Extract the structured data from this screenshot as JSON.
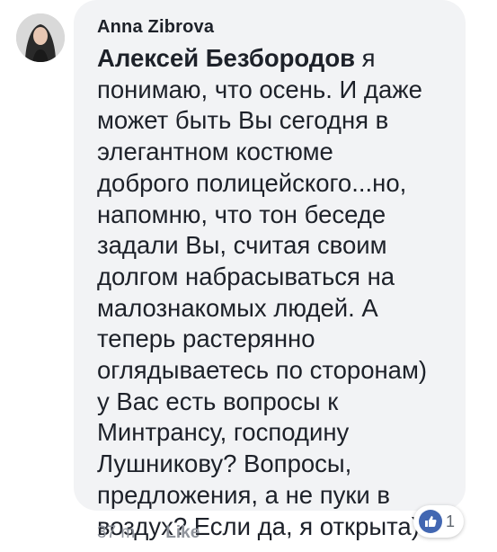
{
  "comment": {
    "author": "Anna Zibrova",
    "mention": "Алексей Безбородов",
    "text_lines": [
      " я",
      "понимаю, что осень. И даже",
      "может быть Вы сегодня в",
      "элегантном костюме",
      "доброго полицейского...но,",
      "напомню, что тон беседе",
      "задали Вы, считая своим",
      "долгом набрасываться на",
      "малознакомых людей. А",
      "теперь растерянно",
      "оглядываетесь по сторонам)",
      "у Вас есть вопросы к",
      "Минтрансу, господину",
      "Лушникову? Вопросы,",
      "предложения, а не пуки в",
      "воздух? Если да, я открыта)"
    ],
    "timestamp": "37 m",
    "like_label": "Like",
    "reaction_count": "1",
    "reaction_icon": "thumbs-up-icon",
    "colors": {
      "bubble": "#f2f3f5",
      "text": "#1d2129",
      "meta": "#90949c",
      "like_blue": "#4267b2"
    }
  }
}
